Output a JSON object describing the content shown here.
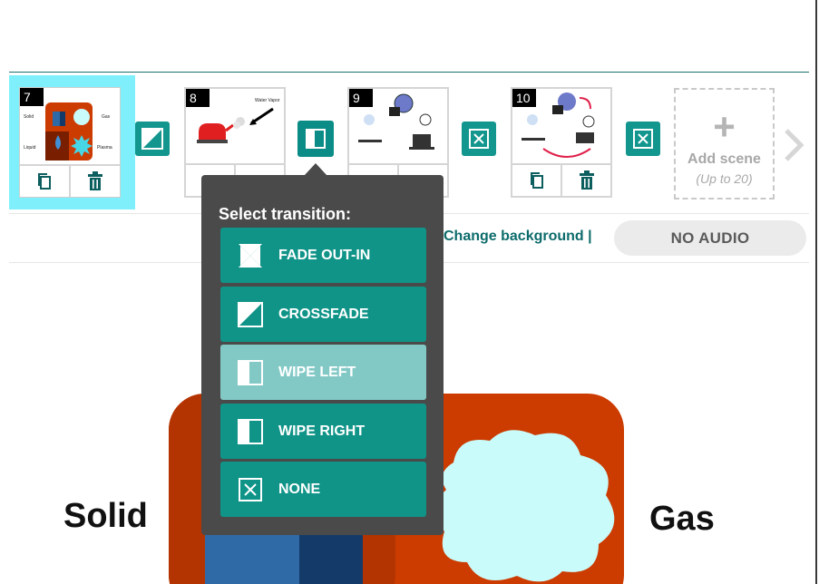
{
  "scenes": [
    {
      "number": "7",
      "thumb_labels": [
        "Solid",
        "Gas",
        "Liquid",
        "Plasma"
      ],
      "selected": true
    },
    {
      "number": "8",
      "thumb_labels": [
        "Water Vapor"
      ],
      "selected": false
    },
    {
      "number": "9",
      "thumb_labels": [],
      "selected": false
    },
    {
      "number": "10",
      "thumb_labels": [],
      "selected": false
    }
  ],
  "scene_buttons": {
    "duplicate": "duplicate-icon",
    "delete": "trash-icon"
  },
  "add_scene": {
    "title": "Add scene",
    "subtitle": "(Up to 20)"
  },
  "toolbar": {
    "change_background": "Change background |",
    "no_audio": "NO AUDIO"
  },
  "popup": {
    "title": "Select transition:",
    "options": [
      {
        "label": "FADE OUT-IN",
        "icon": "fade-out-in-icon"
      },
      {
        "label": "CROSSFADE",
        "icon": "crossfade-icon"
      },
      {
        "label": "WIPE LEFT",
        "icon": "wipe-left-icon",
        "highlighted": true
      },
      {
        "label": "WIPE RIGHT",
        "icon": "wipe-right-icon"
      },
      {
        "label": "NONE",
        "icon": "none-icon"
      }
    ]
  },
  "canvas": {
    "label_left": "Solid",
    "label_right": "Gas"
  },
  "colors": {
    "teal": "#109488",
    "highlight": "#82c9c6",
    "selected_scene": "#7ff0fb",
    "popup_bg": "#4a4a4a",
    "canvas_orange": "#cc3b00",
    "gas_cloud": "#c9fbfb"
  }
}
